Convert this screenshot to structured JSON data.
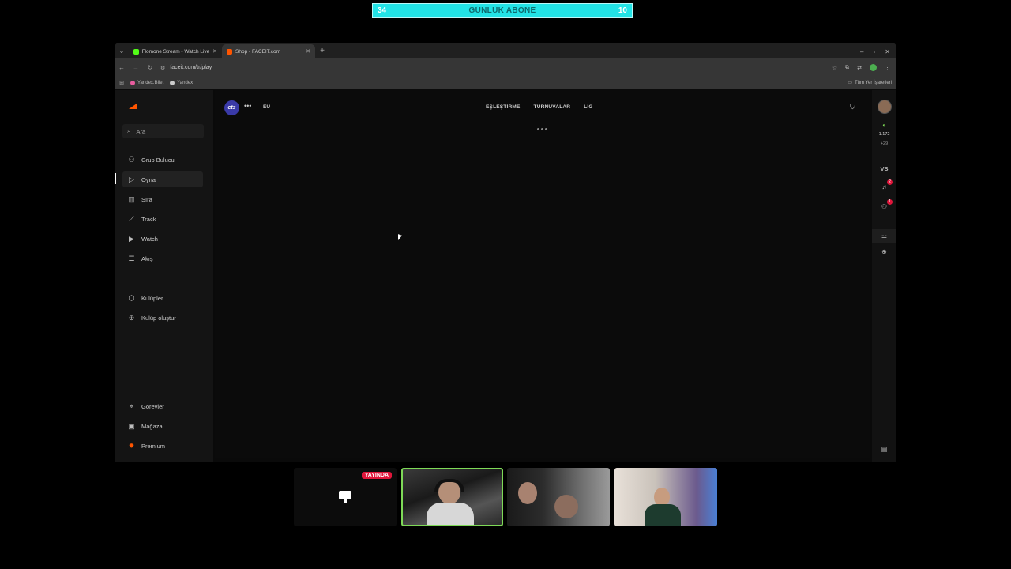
{
  "overlay": {
    "left_count": "34",
    "title": "GÜNLÜK ABONE",
    "right_count": "10"
  },
  "browser": {
    "tabs": [
      {
        "label": "Flomone Stream - Watch Live o",
        "active": false
      },
      {
        "label": "Shop - FACEIT.com",
        "active": true
      }
    ],
    "url": "faceit.com/tr/play",
    "bookmarks": [
      "Yandex.Bilet",
      "Yandex"
    ],
    "all_bookmarks_label": "Tüm Yer İşaretleri"
  },
  "faceit": {
    "sidebar": {
      "search_placeholder": "Ara",
      "nav": [
        {
          "label": "Grup Bulucu",
          "icon": "group-icon"
        },
        {
          "label": "Oyna",
          "icon": "play-icon",
          "active": true
        },
        {
          "label": "Sıra",
          "icon": "ranking-icon"
        },
        {
          "label": "Track",
          "icon": "chart-icon"
        },
        {
          "label": "Watch",
          "icon": "video-icon"
        },
        {
          "label": "Akış",
          "icon": "feed-icon"
        }
      ],
      "clubs": [
        {
          "label": "Kulüpler",
          "icon": "club-icon"
        },
        {
          "label": "Kulüp oluştur",
          "icon": "add-circle-icon"
        }
      ],
      "bottom": [
        {
          "label": "Görevler",
          "icon": "missions-icon"
        },
        {
          "label": "Mağaza",
          "icon": "shop-icon"
        },
        {
          "label": "Premium",
          "icon": "premium-icon"
        }
      ]
    },
    "header": {
      "game_badge": "cts",
      "region": "EU",
      "nav": [
        "EŞLEŞTİRME",
        "TURNUVALAR",
        "LİG"
      ]
    },
    "rightbar": {
      "elo": "1.172",
      "elo_change": "+29",
      "vs_label": "VS",
      "notif_count": "2",
      "friends_count": "1"
    }
  },
  "stream": {
    "live_badge": "YAYINDA"
  },
  "colors": {
    "overlay_bg": "#22e3e6",
    "faceit_orange": "#ff5500",
    "live_red": "#e0163b",
    "active_cam_border": "#7ed957"
  }
}
